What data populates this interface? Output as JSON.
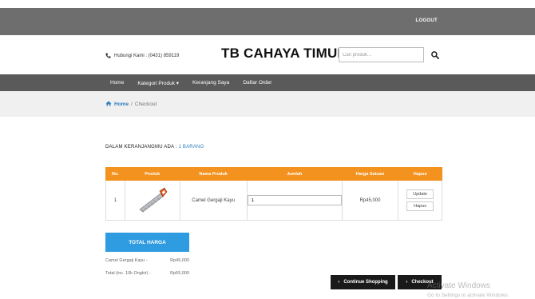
{
  "topbar": {
    "logout_label": "LOGOUT"
  },
  "header": {
    "contact": "Hubungi Kami : (0431) 859119",
    "brand": "TB CAHAYA TIMUR",
    "search_placeholder": "Cari produk..."
  },
  "nav": {
    "items": [
      {
        "label": "Home"
      },
      {
        "label": "Kategori Produk"
      },
      {
        "label": "Keranjang Saya"
      },
      {
        "label": "Daftar Order"
      }
    ]
  },
  "breadcrumb": {
    "home": "Home",
    "separator": "/",
    "current": "Checkout"
  },
  "cart": {
    "summary_prefix": "DALAM KERANJANGMU ADA :",
    "summary_count": "1 BARANG",
    "columns": [
      "No.",
      "Produk",
      "Nama Produk",
      "Jumlah",
      "Harga Satuan",
      "Hapus"
    ],
    "rows": [
      {
        "no": "1",
        "name": "Camel Gergaji Kayu",
        "qty": "1",
        "price": "Rp45,000",
        "update_label": "Update",
        "delete_label": "Hapus"
      }
    ]
  },
  "totals": {
    "header": "TOTAL HARGA",
    "lines": [
      {
        "label": "Camel Gergaji Kayu -",
        "value": "Rp45,000"
      },
      {
        "label": "Total (inc. 10k Ongkir) -",
        "value": "Rp55,000"
      }
    ]
  },
  "actions": {
    "continue_label": "Continue Shopping",
    "checkout_label": "Checkout"
  },
  "watermark": {
    "line1": "Activate Windows",
    "line2": "Go to Settings to activate Windows."
  },
  "colors": {
    "accent_orange": "#f4921f",
    "accent_blue": "#2f9be0",
    "topbar": "#6e6e6e",
    "navbar": "#5a5a5a"
  },
  "icons": {
    "phone": "phone-icon",
    "search": "search-icon",
    "home": "home-icon",
    "product": "saw-icon",
    "prev": "chevron-left-icon",
    "next": "chevron-right-icon"
  }
}
